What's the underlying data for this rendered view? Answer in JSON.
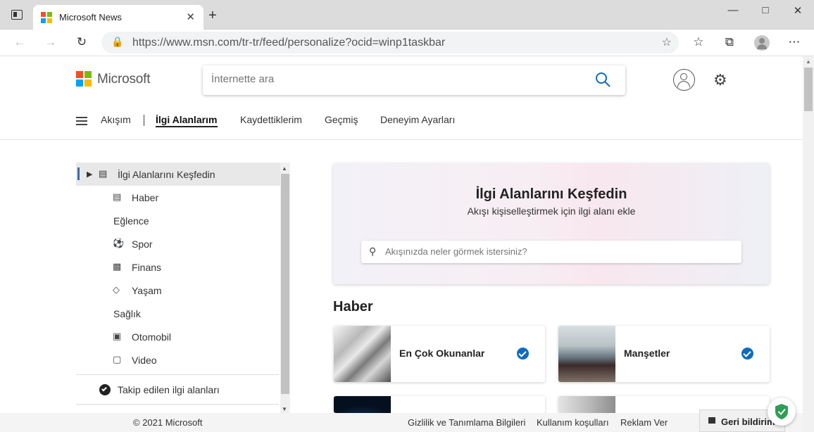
{
  "browser": {
    "tab_title": "Microsoft News",
    "close_tab": "✕",
    "new_tab": "+",
    "url": "https://www.msn.com/tr-tr/feed/personalize?ocid=winp1taskbar"
  },
  "header": {
    "brand": "Microsoft",
    "search_placeholder": "İnternette ara",
    "nav": [
      "Akışım",
      "İlgi Alanlarım",
      "Kaydettiklerim",
      "Geçmiş",
      "Deneyim Ayarları"
    ]
  },
  "sidebar": {
    "root": "İlgi Alanlarını Keşfedin",
    "items": [
      "Haber",
      "Eğlence",
      "Spor",
      "Finans",
      "Yaşam",
      "Sağlık",
      "Otomobil",
      "Video"
    ],
    "followed": "Takip edilen ilgi alanları"
  },
  "explore": {
    "title": "İlgi Alanlarını Keşfedin",
    "subtitle": "Akışı kişiselleştirmek için ilgi alanı ekle",
    "search_placeholder": "Akışınızda neler görmek istersiniz?"
  },
  "section": {
    "title": "Haber",
    "cards": [
      {
        "title": "En Çok Okunanlar",
        "checked": true
      },
      {
        "title": "Manşetler",
        "checked": true
      }
    ]
  },
  "footer": {
    "copyright": "© 2021 Microsoft",
    "links": [
      "Gizlilik ve Tanımlama Bilgileri",
      "Kullanım koşulları",
      "Reklam Ver"
    ],
    "feedback": "Geri bildirim"
  },
  "colors": {
    "accent": "#0f6cbd",
    "shield": "#2e9e55"
  }
}
